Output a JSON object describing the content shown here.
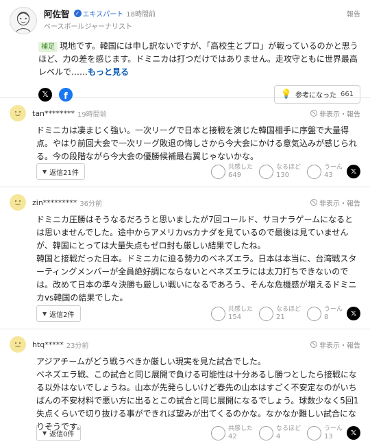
{
  "expert": {
    "name": "阿佐智",
    "badge": "エキスパート",
    "time": "18時間前",
    "role": "ベースボールジャーナリスト",
    "report": "報告",
    "tag": "補足",
    "body": "現地です。韓国には申し訳ないですが、「高校生とプロ」が戦っているのかと思うほど、力の差を感じます。ドミニカは打つだけではありません。走攻守ともに世界最高レベルで……",
    "more": "もっと見る",
    "helpful_label": "参考になった",
    "helpful_count": "661"
  },
  "comments": [
    {
      "user": "tan********",
      "time": "19時間前",
      "report": "非表示・報告",
      "body": "ドミニカは凄まじく強い。一次リーグで日本と接戦を演じた韓国相手に序盤で大量得点。やはり前回大会で一次リーグ敗退の悔しさから今大会にかける意気込みが感じられる。今の段階ながら今大会の優勝候補最右翼じゃないかな。",
      "reply": "返信21件",
      "reactions": [
        {
          "label": "共感した",
          "count": "649"
        },
        {
          "label": "なるほど",
          "count": "130"
        },
        {
          "label": "うーん",
          "count": "43"
        }
      ]
    },
    {
      "user": "zin*********",
      "time": "36分前",
      "report": "非表示・報告",
      "body": "ドミニカ圧勝はそうなるだろうと思いましたが7回コールド、サヨナラゲームになるとは思いませんでした。途中からアメリカvsカナダを見ているので最後は見ていませんが、韓国にとっては大量失点もゼロ封も厳しい結果でしたね。\n韓国と接戦だった日本。ドミニカに迫る勢力のベネズエラ。日本は本当に、台湾戦スターティングメンバーが全員絶好調にならないとベネズエラには太刀打ちできないのでは。改めて日本の準々決勝も厳しい戦いになるであろう、そんな危機感が増えるドミニカvs韓国の結果でした。",
      "reply": "返信2件",
      "reactions": [
        {
          "label": "共感した",
          "count": "154"
        },
        {
          "label": "なるほど",
          "count": "21"
        },
        {
          "label": "うーん",
          "count": "8"
        }
      ]
    },
    {
      "user": "htq*****",
      "time": "23分前",
      "report": "非表示・報告",
      "body": "アジアチームがどう戦うべきか厳しい現実を見た試合でした。\nベネズエラ戦、この試合と同じ展開で負ける可能性は十分あるし勝つとしたら接戦になる以外はないでしょうね。山本が先発らしいけど春先の山本はすごく不安定なのがいちばんの不安材料で悪い方に出るとこの試合と同じ展開になるでしょう。球数少なく5回1失点くらいで切り抜ける事ができれば望みが出てくるのかな。なかなか難しい試合になりそうです。",
      "reply": "返信0件",
      "reactions": [
        {
          "label": "共感した",
          "count": "42"
        },
        {
          "label": "なるほど",
          "count": "4"
        },
        {
          "label": "うーん",
          "count": "13"
        }
      ]
    }
  ]
}
